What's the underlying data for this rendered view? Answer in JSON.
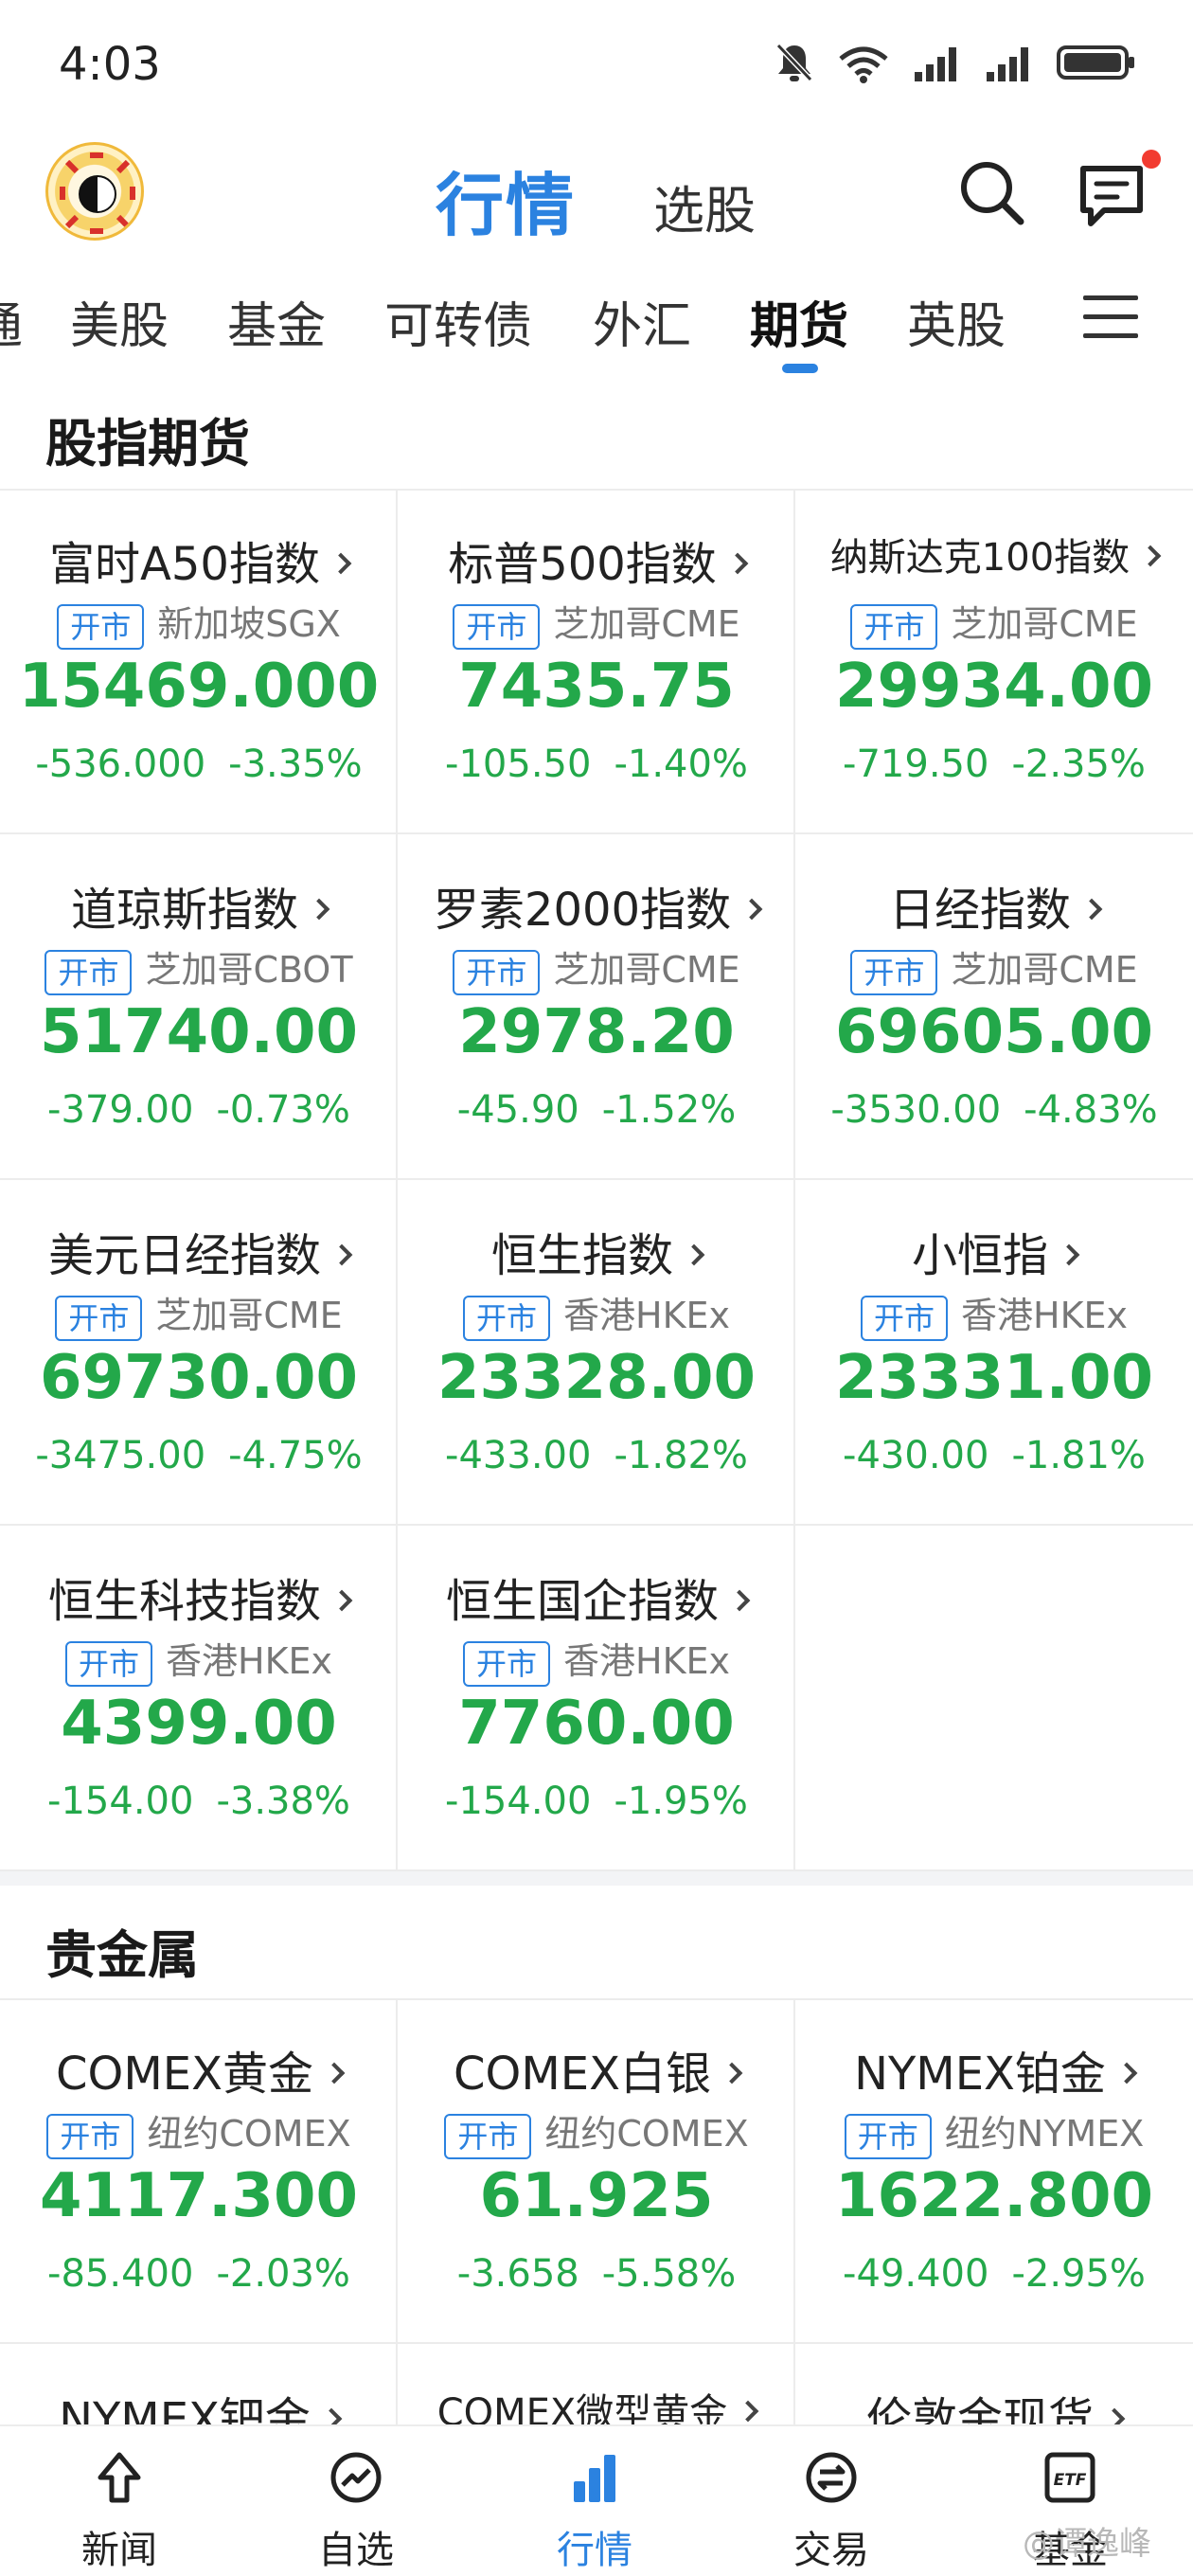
{
  "status_bar": {
    "time": "4:03"
  },
  "header": {
    "title": "行情",
    "subtitle": "选股"
  },
  "tabs": [
    {
      "label": "通"
    },
    {
      "label": "美股"
    },
    {
      "label": "基金"
    },
    {
      "label": "可转债"
    },
    {
      "label": "外汇"
    },
    {
      "label": "期货",
      "active": true
    },
    {
      "label": "英股"
    }
  ],
  "sections": [
    {
      "title": "股指期货",
      "items": [
        {
          "name": "富时A50指数",
          "badge": "开市",
          "exchange": "新加坡SGX",
          "price": "15469.000",
          "change": "-536.000",
          "percent": "-3.35%"
        },
        {
          "name": "标普500指数",
          "badge": "开市",
          "exchange": "芝加哥CME",
          "price": "7435.75",
          "change": "-105.50",
          "percent": "-1.40%"
        },
        {
          "name": "纳斯达克100指数",
          "badge": "开市",
          "exchange": "芝加哥CME",
          "price": "29934.00",
          "change": "-719.50",
          "percent": "-2.35%"
        },
        {
          "name": "道琼斯指数",
          "badge": "开市",
          "exchange": "芝加哥CBOT",
          "price": "51740.00",
          "change": "-379.00",
          "percent": "-0.73%"
        },
        {
          "name": "罗素2000指数",
          "badge": "开市",
          "exchange": "芝加哥CME",
          "price": "2978.20",
          "change": "-45.90",
          "percent": "-1.52%"
        },
        {
          "name": "日经指数",
          "badge": "开市",
          "exchange": "芝加哥CME",
          "price": "69605.00",
          "change": "-3530.00",
          "percent": "-4.83%"
        },
        {
          "name": "美元日经指数",
          "badge": "开市",
          "exchange": "芝加哥CME",
          "price": "69730.00",
          "change": "-3475.00",
          "percent": "-4.75%"
        },
        {
          "name": "恒生指数",
          "badge": "开市",
          "exchange": "香港HKEx",
          "price": "23328.00",
          "change": "-433.00",
          "percent": "-1.82%"
        },
        {
          "name": "小恒指",
          "badge": "开市",
          "exchange": "香港HKEx",
          "price": "23331.00",
          "change": "-430.00",
          "percent": "-1.81%"
        },
        {
          "name": "恒生科技指数",
          "badge": "开市",
          "exchange": "香港HKEx",
          "price": "4399.00",
          "change": "-154.00",
          "percent": "-3.38%"
        },
        {
          "name": "恒生国企指数",
          "badge": "开市",
          "exchange": "香港HKEx",
          "price": "7760.00",
          "change": "-154.00",
          "percent": "-1.95%"
        }
      ]
    },
    {
      "title": "贵金属",
      "items": [
        {
          "name": "COMEX黄金",
          "badge": "开市",
          "exchange": "纽约COMEX",
          "price": "4117.300",
          "change": "-85.400",
          "percent": "-2.03%"
        },
        {
          "name": "COMEX白银",
          "badge": "开市",
          "exchange": "纽约COMEX",
          "price": "61.925",
          "change": "-3.658",
          "percent": "-5.58%"
        },
        {
          "name": "NYMEX铂金",
          "badge": "开市",
          "exchange": "纽约NYMEX",
          "price": "1622.800",
          "change": "-49.400",
          "percent": "-2.95%"
        },
        {
          "name": "NYMEX钯金"
        },
        {
          "name": "COMEX微型黄金"
        },
        {
          "name": "伦敦金现货"
        }
      ]
    }
  ],
  "bottom_nav": [
    {
      "label": "新闻",
      "icon": "news-icon"
    },
    {
      "label": "自选",
      "icon": "watchlist-icon"
    },
    {
      "label": "行情",
      "icon": "market-icon",
      "active": true
    },
    {
      "label": "交易",
      "icon": "trade-icon"
    },
    {
      "label": "基金",
      "icon": "etf-icon"
    }
  ],
  "watermark": "@谭逸峰",
  "colors": {
    "accent": "#2b82e0",
    "down": "#23a84a",
    "notify": "#f23b30"
  }
}
